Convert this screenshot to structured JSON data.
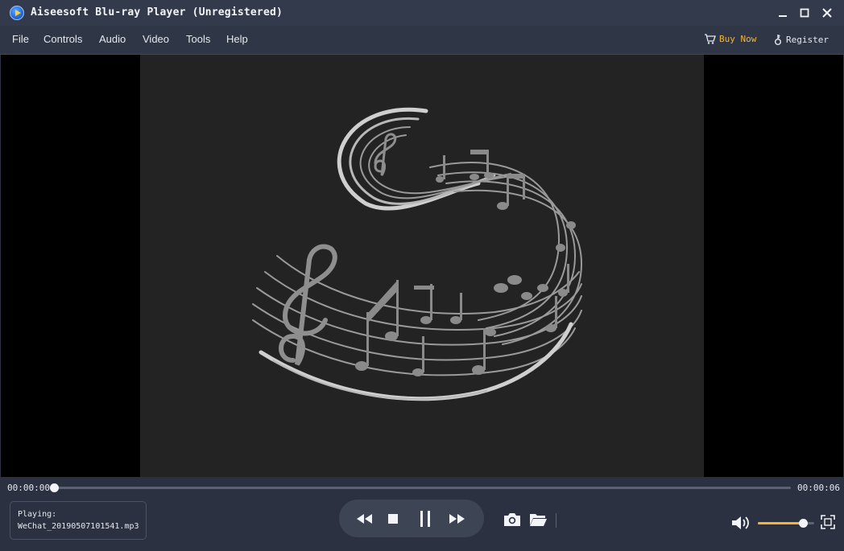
{
  "window": {
    "title": "Aiseesoft Blu-ray Player (Unregistered)",
    "icons": [
      "app-logo-icon",
      "minimize-icon",
      "maximize-icon",
      "close-icon"
    ]
  },
  "menu": {
    "items": [
      {
        "label": "File"
      },
      {
        "label": "Controls"
      },
      {
        "label": "Audio"
      },
      {
        "label": "Video"
      },
      {
        "label": "Tools"
      },
      {
        "label": "Help"
      }
    ],
    "buy_now": "Buy Now",
    "register": "Register"
  },
  "colors": {
    "accent": "#f4b43a",
    "background": "#2b3140",
    "titlebar": "#323a4b",
    "artwork_bg": "#232323"
  },
  "playback": {
    "current_time": "00:00:00",
    "total_time": "00:00:06",
    "progress_fraction": 0.0,
    "volume_fraction": 0.8,
    "state": "playing"
  },
  "now_playing": {
    "label": "Playing:",
    "file": "WeChat_20190507101541.mp3"
  },
  "transport": {
    "icons": [
      "rewind-icon",
      "stop-icon",
      "pause-icon",
      "fast-forward-icon"
    ]
  },
  "tools": {
    "icons": [
      "camera-icon",
      "folder-icon",
      "volume-icon",
      "fullscreen-icon"
    ]
  }
}
